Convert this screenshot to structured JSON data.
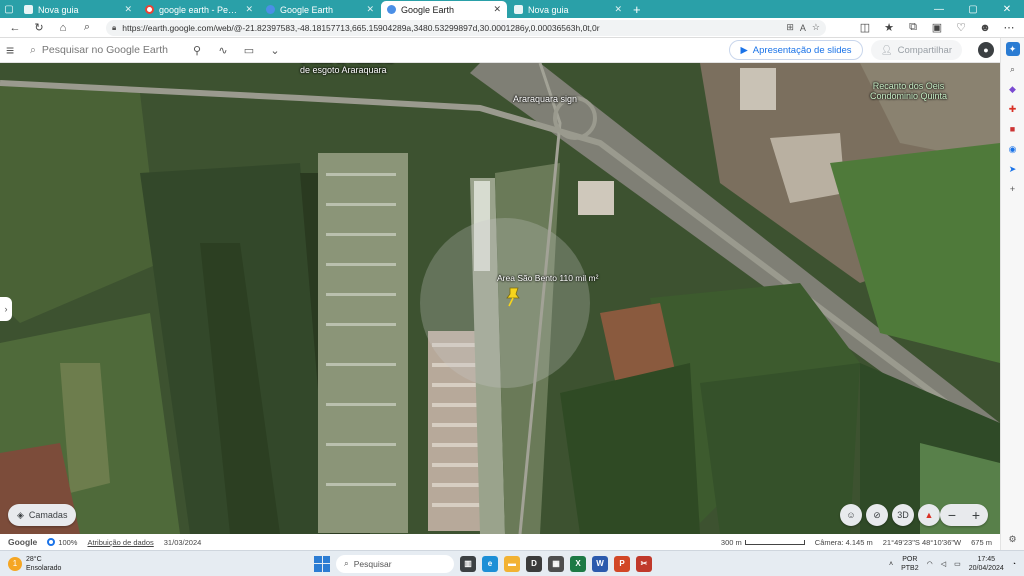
{
  "browser": {
    "tabs": [
      {
        "label": "Nova guia",
        "active": false,
        "icon": "page-icon"
      },
      {
        "label": "google earth - Pesquisar",
        "active": false,
        "icon": "google-icon"
      },
      {
        "label": "Google Earth",
        "active": false,
        "icon": "earth-icon"
      },
      {
        "label": "Google Earth",
        "active": true,
        "icon": "earth-icon"
      },
      {
        "label": "Nova guia",
        "active": false,
        "icon": "page-icon"
      }
    ],
    "url": "https://earth.google.com/web/@-21.82397583,-48.18157713,665.15904289a,3480.53299897d,30.0001286y,0.00036563h,0t,0r"
  },
  "earth_toolbar": {
    "search_placeholder": "Pesquisar no Google Earth",
    "slides_label": "Apresentação de slides",
    "share_label": "Compartilhar"
  },
  "map": {
    "labels": {
      "sewage": "Unidade de Tratamento\nde esgoto Araraquara",
      "sign": "Araraquara sign",
      "condo": "Recanto dos Oeis\nCondominio Quinta",
      "placemark": "Area São Bento 110 mil m²"
    },
    "layers_label": "Camadas",
    "view_3d_label": "3D"
  },
  "status": {
    "brand": "Google",
    "quality": "100%",
    "attribution": "Atribuição de dados",
    "date": "31/03/2024",
    "scale": "300 m",
    "camera": "Câmera: 4.145 m",
    "coords": "21°49'23\"S 48°10'36\"W",
    "elevation": "675 m"
  },
  "taskbar": {
    "temperature": "28°C",
    "weather": "Ensolarado",
    "weather_badge": "1",
    "search_placeholder": "Pesquisar",
    "lang_top": "POR",
    "lang_bottom": "PTB2",
    "time": "17:45",
    "date": "20/04/2024"
  },
  "colors": {
    "tabstrip": "#2aa0a8",
    "accent": "#1a73e8"
  }
}
